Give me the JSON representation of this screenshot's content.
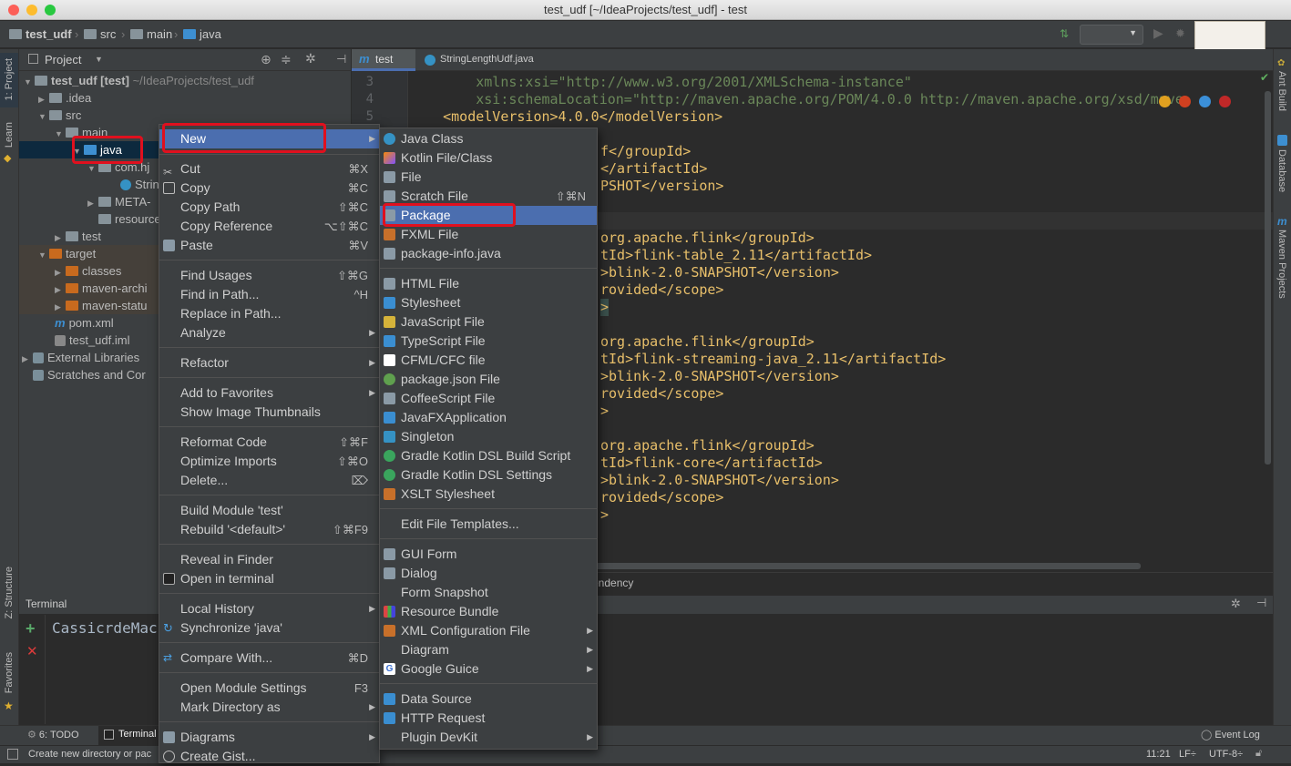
{
  "window": {
    "title": "test_udf [~/IdeaProjects/test_udf] - test"
  },
  "breadcrumbs": [
    "test_udf",
    "src",
    "main",
    "java"
  ],
  "colors": {
    "accent": "#4b6eaf",
    "highlight_border": "#e0101e",
    "panel_bg": "#3c3f41",
    "editor_bg": "#2b2b2b"
  },
  "left_strip": {
    "project": "1: Project",
    "learn": "Learn",
    "structure": "Z: Structure",
    "favorites": "Favorites"
  },
  "right_strip": {
    "ant": "Ant Build",
    "database": "Database",
    "maven": "Maven Projects"
  },
  "project_panel": {
    "title": "Project",
    "tree": [
      {
        "label": "test_udf [test]",
        "extra": "~/IdeaProjects/test_udf"
      },
      {
        "label": ".idea"
      },
      {
        "label": "src"
      },
      {
        "label": "main"
      },
      {
        "label": "java"
      },
      {
        "label": "com.hj"
      },
      {
        "label": "Strin"
      },
      {
        "label": "META-"
      },
      {
        "label": "resources"
      },
      {
        "label": "test"
      },
      {
        "label": "target"
      },
      {
        "label": "classes"
      },
      {
        "label": "maven-archi"
      },
      {
        "label": "maven-statu"
      },
      {
        "label": "pom.xml"
      },
      {
        "label": "test_udf.iml"
      },
      {
        "label": "External Libraries"
      },
      {
        "label": "Scratches and Cor"
      }
    ]
  },
  "editor": {
    "tabs": [
      "test",
      "StringLengthUdf.java"
    ],
    "line_numbers": [
      "3",
      "4",
      "5"
    ],
    "lines": [
      "        xmlns:xsi=\"http://www.w3.org/2001/XMLSchema-instance\"",
      "        xsi:schemaLocation=\"http://maven.apache.org/POM/4.0.0 http://maven.apache.org/xsd/mave",
      "    <modelVersion>4.0.0</modelVersion>",
      "f</groupId>",
      "</artifactId>",
      "PSHOT</version>",
      "org.apache.flink</groupId>",
      "tId>flink-table_2.11</artifactId>",
      ">blink-2.0-SNAPSHOT</version>",
      "rovided</scope>",
      ">",
      "org.apache.flink</groupId>",
      "tId>flink-streaming-java_2.11</artifactId>",
      ">blink-2.0-SNAPSHOT</version>",
      "rovided</scope>",
      ">",
      "org.apache.flink</groupId>",
      "tId>flink-core</artifactId>",
      ">blink-2.0-SNAPSHOT</version>",
      "rovided</scope>",
      ">"
    ],
    "bottom_crumb": "endency"
  },
  "terminal": {
    "title": "Terminal",
    "prompt": "CassicrdeMac"
  },
  "bottom_tabs": {
    "todo": "6: TODO",
    "terminal": "Terminal",
    "event_log": "Event Log"
  },
  "status": {
    "hint": "Create new directory or pac",
    "time": "11:21",
    "line_sep": "LF÷",
    "encoding": "UTF-8÷"
  },
  "context_menu": {
    "items": [
      {
        "label": "New",
        "shortcut": "",
        "submenu": true
      },
      {
        "label": "Cut",
        "shortcut": "⌘X"
      },
      {
        "label": "Copy",
        "shortcut": "⌘C"
      },
      {
        "label": "Copy Path",
        "shortcut": "⇧⌘C"
      },
      {
        "label": "Copy Reference",
        "shortcut": "⌥⇧⌘C"
      },
      {
        "label": "Paste",
        "shortcut": "⌘V"
      },
      {
        "label": "Find Usages",
        "shortcut": "⇧⌘G"
      },
      {
        "label": "Find in Path...",
        "shortcut": "^H"
      },
      {
        "label": "Replace in Path...",
        "shortcut": ""
      },
      {
        "label": "Analyze",
        "shortcut": "",
        "submenu": true
      },
      {
        "label": "Refactor",
        "shortcut": "",
        "submenu": true
      },
      {
        "label": "Add to Favorites",
        "shortcut": "",
        "submenu": true
      },
      {
        "label": "Show Image Thumbnails",
        "shortcut": ""
      },
      {
        "label": "Reformat Code",
        "shortcut": "⇧⌘F"
      },
      {
        "label": "Optimize Imports",
        "shortcut": "⇧⌘O"
      },
      {
        "label": "Delete...",
        "shortcut": "⌦"
      },
      {
        "label": "Build Module 'test'",
        "shortcut": ""
      },
      {
        "label": "Rebuild '<default>'",
        "shortcut": "⇧⌘F9"
      },
      {
        "label": "Reveal in Finder",
        "shortcut": ""
      },
      {
        "label": "Open in terminal",
        "shortcut": ""
      },
      {
        "label": "Local History",
        "shortcut": "",
        "submenu": true
      },
      {
        "label": "Synchronize 'java'",
        "shortcut": ""
      },
      {
        "label": "Compare With...",
        "shortcut": "⌘D"
      },
      {
        "label": "Open Module Settings",
        "shortcut": "F3"
      },
      {
        "label": "Mark Directory as",
        "shortcut": "",
        "submenu": true
      },
      {
        "label": "Diagrams",
        "shortcut": "",
        "submenu": true
      },
      {
        "label": "Create Gist...",
        "shortcut": ""
      }
    ]
  },
  "new_submenu": {
    "items": [
      {
        "label": "Java Class",
        "shortcut": ""
      },
      {
        "label": "Kotlin File/Class",
        "shortcut": ""
      },
      {
        "label": "File",
        "shortcut": ""
      },
      {
        "label": "Scratch File",
        "shortcut": "⇧⌘N"
      },
      {
        "label": "Package",
        "shortcut": ""
      },
      {
        "label": "FXML File",
        "shortcut": ""
      },
      {
        "label": "package-info.java",
        "shortcut": ""
      },
      {
        "label": "HTML File",
        "shortcut": ""
      },
      {
        "label": "Stylesheet",
        "shortcut": ""
      },
      {
        "label": "JavaScript File",
        "shortcut": ""
      },
      {
        "label": "TypeScript File",
        "shortcut": ""
      },
      {
        "label": "CFML/CFC file",
        "shortcut": ""
      },
      {
        "label": "package.json File",
        "shortcut": ""
      },
      {
        "label": "CoffeeScript File",
        "shortcut": ""
      },
      {
        "label": "JavaFXApplication",
        "shortcut": ""
      },
      {
        "label": "Singleton",
        "shortcut": ""
      },
      {
        "label": "Gradle Kotlin DSL Build Script",
        "shortcut": ""
      },
      {
        "label": "Gradle Kotlin DSL Settings",
        "shortcut": ""
      },
      {
        "label": "XSLT Stylesheet",
        "shortcut": ""
      },
      {
        "label": "Edit File Templates...",
        "shortcut": ""
      },
      {
        "label": "GUI Form",
        "shortcut": ""
      },
      {
        "label": "Dialog",
        "shortcut": ""
      },
      {
        "label": "Form Snapshot",
        "shortcut": ""
      },
      {
        "label": "Resource Bundle",
        "shortcut": ""
      },
      {
        "label": "XML Configuration File",
        "shortcut": "",
        "submenu": true
      },
      {
        "label": "Diagram",
        "shortcut": "",
        "submenu": true
      },
      {
        "label": "Google Guice",
        "shortcut": "",
        "submenu": true
      },
      {
        "label": "Data Source",
        "shortcut": ""
      },
      {
        "label": "HTTP Request",
        "shortcut": ""
      },
      {
        "label": "Plugin DevKit",
        "shortcut": "",
        "submenu": true
      }
    ]
  }
}
